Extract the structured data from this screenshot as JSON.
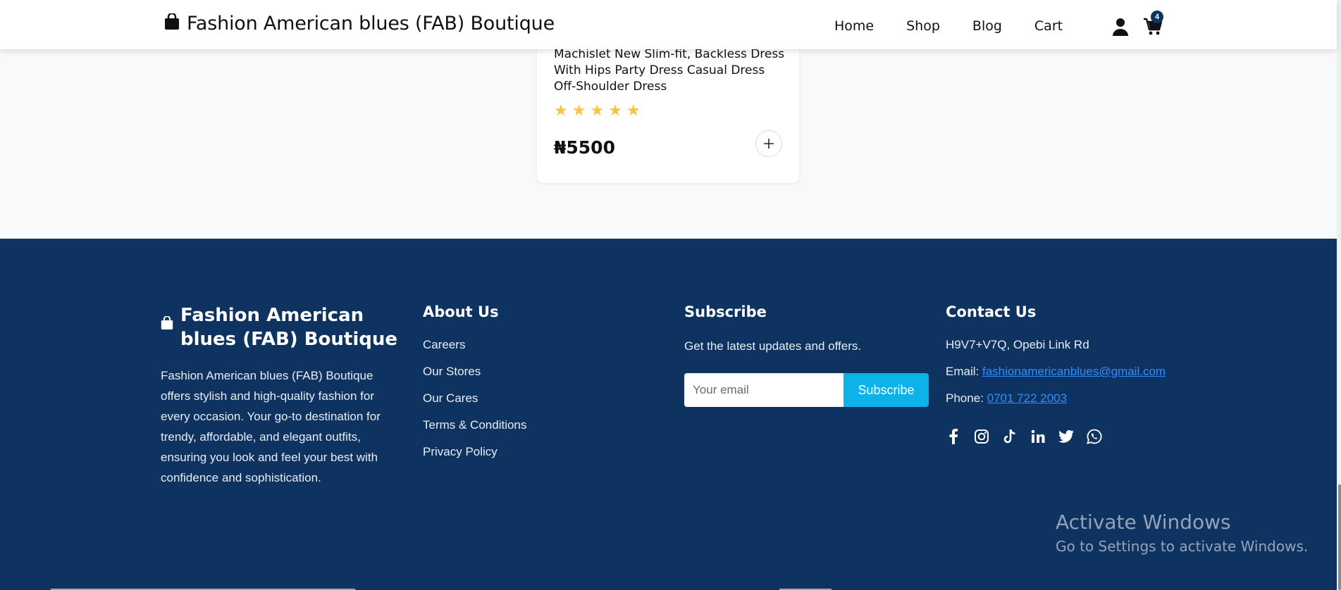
{
  "header": {
    "brand": "Fashion American blues (FAB) Boutique",
    "nav": [
      "Home",
      "Shop",
      "Blog",
      "Cart"
    ],
    "cart_count": "4"
  },
  "product": {
    "title": "Machislet New Slim-fit, Backless Dress With Hips Party Dress Casual Dress Off-Shoulder Dress",
    "rating": 5,
    "price": "₦5500"
  },
  "footer": {
    "brand": "Fashion American blues (FAB) Boutique",
    "description": "Fashion American blues (FAB) Boutique offers stylish and high-quality fashion for every occasion. Your go-to destination for trendy, affordable, and elegant outfits, ensuring you look and feel your best with confidence and sophistication.",
    "about": {
      "heading": "About Us",
      "links": [
        "Careers",
        "Our Stores",
        "Our Cares",
        "Terms & Conditions",
        "Privacy Policy"
      ]
    },
    "subscribe": {
      "heading": "Subscribe",
      "text": "Get the latest updates and offers.",
      "placeholder": "Your email",
      "button": "Subscribe"
    },
    "contact": {
      "heading": "Contact Us",
      "address": "H9V7+V7Q, Opebi Link Rd",
      "email_label": "Email:",
      "email": "fashionamericanblues@gmail.com",
      "phone_label": "Phone:",
      "phone": "0701 722 2003"
    },
    "socials": [
      "facebook-icon",
      "instagram-icon",
      "tiktok-icon",
      "linkedin-icon",
      "twitter-icon",
      "whatsapp-icon"
    ]
  },
  "watermark": {
    "title": "Activate Windows",
    "subtitle": "Go to Settings to activate Windows."
  },
  "colors": {
    "footer_bg": "#0f3360",
    "accent": "#0bb3e8",
    "star": "#f6c343",
    "link": "#2f8cff"
  }
}
